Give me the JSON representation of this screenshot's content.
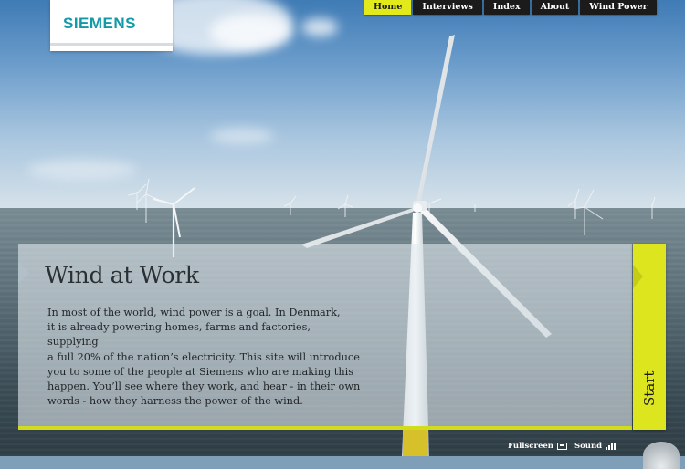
{
  "logo": {
    "text": "SIEMENS",
    "color": "#129aa8"
  },
  "nav": {
    "items": [
      {
        "label": "Home",
        "active": true
      },
      {
        "label": "Interviews",
        "active": false
      },
      {
        "label": "Index",
        "active": false
      },
      {
        "label": "About",
        "active": false
      },
      {
        "label": "Wind Power",
        "active": false
      }
    ],
    "active_color": "#e2ea1b",
    "inactive_color": "#1b1b1b"
  },
  "intro": {
    "title": "Wind at Work",
    "body_lines": [
      "In most of the world, wind power is a goal. In Denmark,",
      "it is already powering homes, farms and factories, supplying",
      "a full 20% of the nation’s electricity. This site will introduce",
      "you to some of the people at Siemens who are making this",
      "happen. You’ll see where they work, and hear - in their own",
      "words - how they harness the power of the wind."
    ]
  },
  "start_tab": {
    "label": "Start",
    "color": "#dde51f"
  },
  "controls": {
    "fullscreen_label": "Fullscreen",
    "sound_label": "Sound"
  },
  "icons": {
    "fullscreen": "fullscreen-icon",
    "sound": "sound-bars-icon"
  }
}
